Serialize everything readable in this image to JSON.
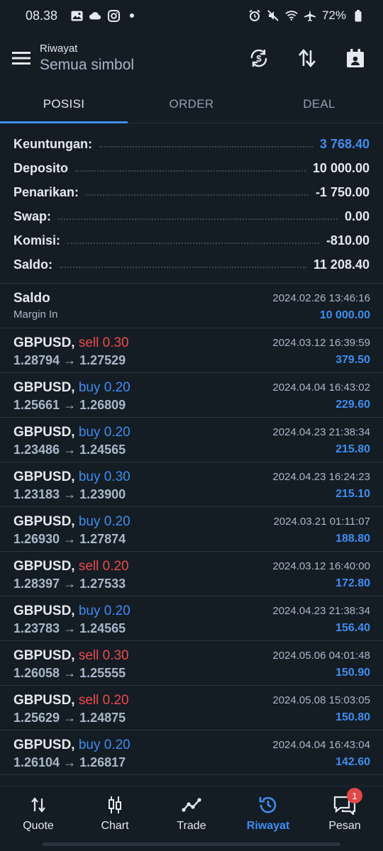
{
  "status_bar": {
    "time": "08.38",
    "battery": "72%"
  },
  "header": {
    "subtitle": "Riwayat",
    "title": "Semua simbol"
  },
  "tabs": [
    {
      "label": "POSISI",
      "active": true
    },
    {
      "label": "ORDER",
      "active": false
    },
    {
      "label": "DEAL",
      "active": false
    }
  ],
  "summary": {
    "profit_label": "Keuntungan:",
    "profit_value": "3 768.40",
    "deposit_label": "Deposito",
    "deposit_value": "10 000.00",
    "withdrawal_label": "Penarikan:",
    "withdrawal_value": "-1 750.00",
    "swap_label": "Swap:",
    "swap_value": "0.00",
    "commission_label": "Komisi:",
    "commission_value": "-810.00",
    "balance_label": "Saldo:",
    "balance_value": "11 208.40"
  },
  "balance_entry": {
    "title": "Saldo",
    "subtitle": "Margin In",
    "datetime": "2024.02.26 13:46:16",
    "amount": "10 000.00"
  },
  "deals": [
    {
      "symbol": "GBPUSD,",
      "side": "sell",
      "side_label": "sell 0.30",
      "prices": "1.28794 → 1.27529",
      "datetime": "2024.03.12 16:39:59",
      "profit": "379.50"
    },
    {
      "symbol": "GBPUSD,",
      "side": "buy",
      "side_label": "buy 0.20",
      "prices": "1.25661 → 1.26809",
      "datetime": "2024.04.04 16:43:02",
      "profit": "229.60"
    },
    {
      "symbol": "GBPUSD,",
      "side": "buy",
      "side_label": "buy 0.20",
      "prices": "1.23486 → 1.24565",
      "datetime": "2024.04.23 21:38:34",
      "profit": "215.80"
    },
    {
      "symbol": "GBPUSD,",
      "side": "buy",
      "side_label": "buy 0.30",
      "prices": "1.23183 → 1.23900",
      "datetime": "2024.04.23 16:24:23",
      "profit": "215.10"
    },
    {
      "symbol": "GBPUSD,",
      "side": "buy",
      "side_label": "buy 0.20",
      "prices": "1.26930 → 1.27874",
      "datetime": "2024.03.21 01:11:07",
      "profit": "188.80"
    },
    {
      "symbol": "GBPUSD,",
      "side": "sell",
      "side_label": "sell 0.20",
      "prices": "1.28397 → 1.27533",
      "datetime": "2024.03.12 16:40:00",
      "profit": "172.80"
    },
    {
      "symbol": "GBPUSD,",
      "side": "buy",
      "side_label": "buy 0.20",
      "prices": "1.23783 → 1.24565",
      "datetime": "2024.04.23 21:38:34",
      "profit": "156.40"
    },
    {
      "symbol": "GBPUSD,",
      "side": "sell",
      "side_label": "sell 0.30",
      "prices": "1.26058 → 1.25555",
      "datetime": "2024.05.06 04:01:48",
      "profit": "150.90"
    },
    {
      "symbol": "GBPUSD,",
      "side": "sell",
      "side_label": "sell 0.20",
      "prices": "1.25629 → 1.24875",
      "datetime": "2024.05.08 15:03:05",
      "profit": "150.80"
    },
    {
      "symbol": "GBPUSD,",
      "side": "buy",
      "side_label": "buy 0.20",
      "prices": "1.26104 → 1.26817",
      "datetime": "2024.04.04 16:43:04",
      "profit": "142.60"
    }
  ],
  "bottom_nav": [
    {
      "label": "Quote",
      "icon": "quote-arrows-icon"
    },
    {
      "label": "Chart",
      "icon": "candlestick-icon"
    },
    {
      "label": "Trade",
      "icon": "trade-line-icon"
    },
    {
      "label": "Riwayat",
      "icon": "history-clock-icon",
      "active": true
    },
    {
      "label": "Pesan",
      "icon": "chat-bubble-icon",
      "badge": "1"
    }
  ],
  "colors": {
    "background": "#141c24",
    "accent": "#3d8ef0",
    "sell": "#ee4a4a",
    "muted": "#a9b8c9"
  }
}
